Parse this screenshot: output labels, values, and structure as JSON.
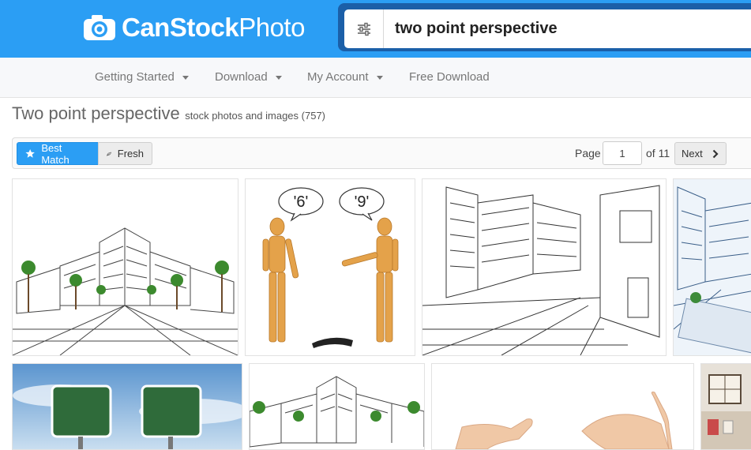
{
  "header": {
    "brand_bold": "CanStock",
    "brand_light": "Photo",
    "search": {
      "value": "two point perspective"
    }
  },
  "nav": {
    "items": [
      {
        "label": "Getting Started",
        "has_dropdown": true
      },
      {
        "label": "Download",
        "has_dropdown": true
      },
      {
        "label": "My Account",
        "has_dropdown": true
      },
      {
        "label": "Free Download",
        "has_dropdown": false
      }
    ]
  },
  "results": {
    "title": "Two point perspective",
    "subtitle": "stock photos and images (757)"
  },
  "toolbar": {
    "best_match_label": "Best Match",
    "fresh_label": "Fresh",
    "page_label": "Page",
    "page_value": "1",
    "of_label": "of 11",
    "next_label": "Next"
  },
  "thumbnails": {
    "t2_bubble_left": "'6'",
    "t2_bubble_right": "'9'"
  },
  "colors": {
    "header_blue": "#2b9ef4",
    "search_border": "#1b5fa8",
    "active_button": "#2b9ef4",
    "nav_background": "#f7f8fa"
  },
  "icons": {
    "logo": "camera-icon",
    "filter": "sliders-icon",
    "best_match": "star-icon",
    "fresh": "leaf-icon",
    "next": "chevron-right-icon",
    "dropdown": "caret-down-icon"
  }
}
